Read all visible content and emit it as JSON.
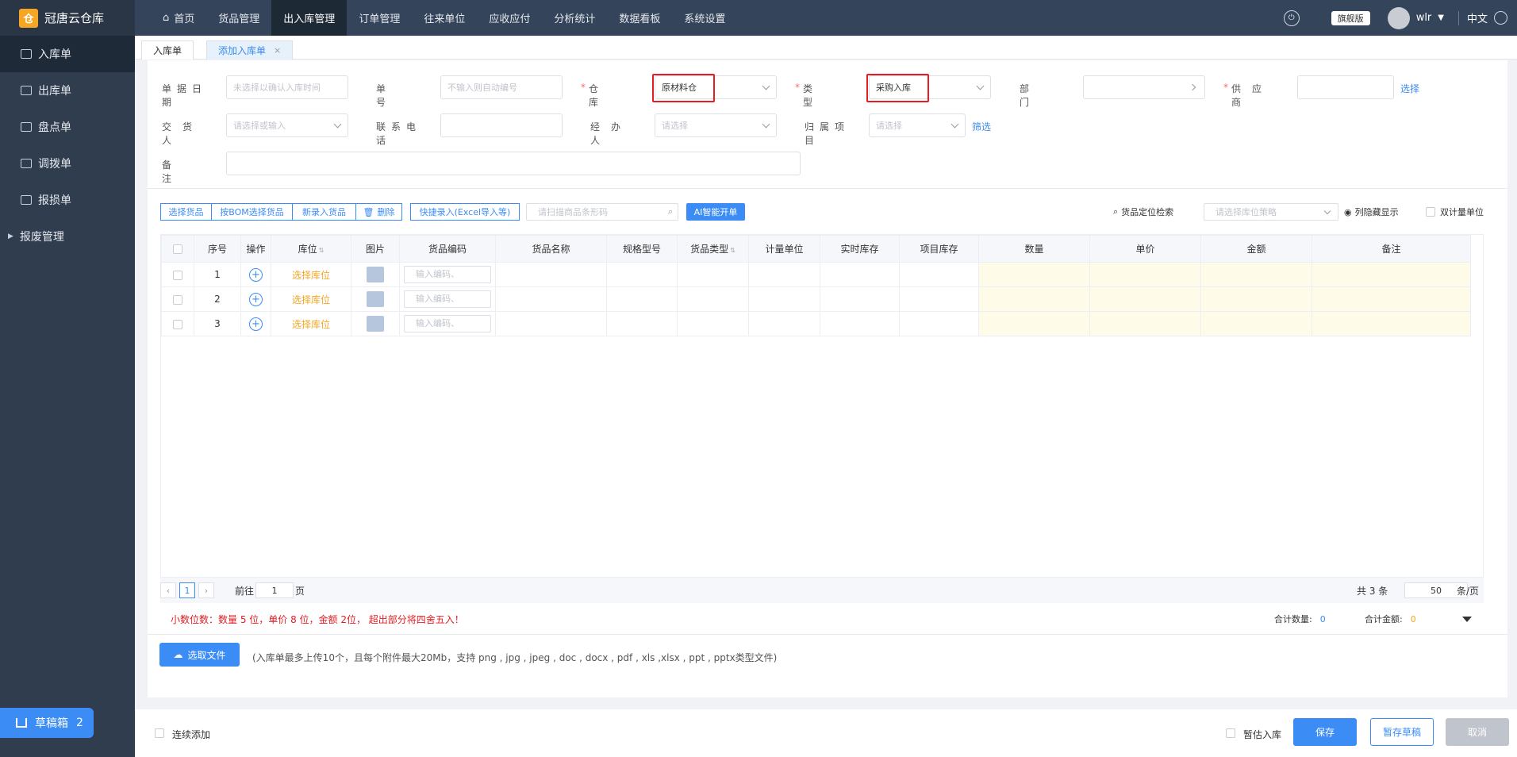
{
  "app": {
    "name": "冠唐云仓库"
  },
  "sidebar": {
    "items": [
      {
        "label": "入库单"
      },
      {
        "label": "出库单"
      },
      {
        "label": "盘点单"
      },
      {
        "label": "调拨单"
      },
      {
        "label": "报损单"
      },
      {
        "label": "报废管理"
      }
    ],
    "drafts": {
      "label": "草稿箱",
      "count": "2"
    }
  },
  "nav": {
    "items": [
      {
        "label": "首页"
      },
      {
        "label": "货品管理"
      },
      {
        "label": "出入库管理"
      },
      {
        "label": "订单管理"
      },
      {
        "label": "往来单位"
      },
      {
        "label": "应收应付"
      },
      {
        "label": "分析统计"
      },
      {
        "label": "数据看板"
      },
      {
        "label": "系统设置"
      }
    ],
    "badge": "旗舰版",
    "user": "wlr",
    "lang": "中文"
  },
  "tabs": [
    {
      "label": "入库单"
    },
    {
      "label": "添加入库单",
      "close": "×"
    }
  ],
  "form": {
    "date": {
      "label": "单据日期",
      "placeholder": "未选择以确认入库时间"
    },
    "number": {
      "label": "单号",
      "placeholder": "不输入则自动编号"
    },
    "warehouse": {
      "label": "仓库",
      "value": "原材料仓"
    },
    "type": {
      "label": "类型",
      "value": "采购入库"
    },
    "dept": {
      "label": "部门"
    },
    "supplier": {
      "label": "供应商",
      "link": "选择"
    },
    "deliverer": {
      "label": "交货人",
      "placeholder": "请选择或输入"
    },
    "phone": {
      "label": "联系电话"
    },
    "handler": {
      "label": "经办人",
      "placeholder": "请选择"
    },
    "project": {
      "label": "归属项目",
      "placeholder": "请选择",
      "link": "筛选"
    },
    "remark": {
      "label": "备注"
    }
  },
  "toolbar": {
    "buttons": [
      "选择货品",
      "按BOM选择货品",
      "新录入货品",
      "删除",
      "快捷录入(Excel导入等)"
    ],
    "scan_placeholder": "请扫描商品条形码",
    "ai": "AI智能开单",
    "locate": "货品定位检索",
    "strategy_placeholder": "请选择库位策略",
    "hide_cols": "列隐藏显示",
    "dual_unit": "双计量单位"
  },
  "table": {
    "columns": [
      "序号",
      "操作",
      "库位",
      "图片",
      "货品编码",
      "货品名称",
      "规格型号",
      "货品类型",
      "计量单位",
      "实时库存",
      "项目库存",
      "数量",
      "单价",
      "金额",
      "备注"
    ],
    "rows": [
      {
        "no": "1",
        "loc": "选择库位",
        "code": "输入编码、"
      },
      {
        "no": "2",
        "loc": "选择库位",
        "code": "输入编码、"
      },
      {
        "no": "3",
        "loc": "选择库位",
        "code": "输入编码、"
      }
    ]
  },
  "pager": {
    "page": "1",
    "goto": "前往",
    "goto_value": "1",
    "page_unit": "页",
    "total": "共 3 条",
    "size": "50",
    "size_unit": "条/页"
  },
  "note": "小数位数：数量 5 位，单价 8 位，金额 2位， 超出部分将四舍五入！",
  "summary": {
    "qty_label": "合计数量:",
    "qty": "0",
    "amt_label": "合计金额:",
    "amt": "0"
  },
  "upload": {
    "button": "选取文件",
    "hint": "(入库单最多上传10个，且每个附件最大20Mb，支持 png , jpg , jpeg , doc , docx , pdf , xls ,xlsx , ppt , pptx类型文件)"
  },
  "footer": {
    "continuous": "连续添加",
    "estimate": "暂估入库",
    "save": "保存",
    "draft": "暂存草稿",
    "cancel": "取消"
  }
}
